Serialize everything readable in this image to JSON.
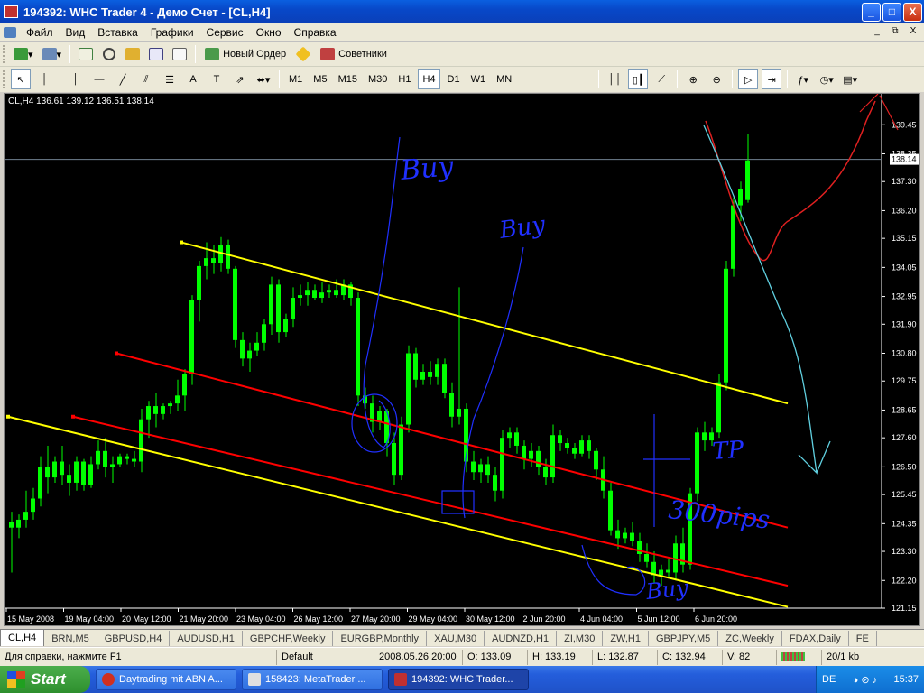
{
  "window": {
    "title": "194392: WHC Trader 4 - Демо Счет - [CL,H4]",
    "buttons": {
      "minimize": "_",
      "maximize": "□",
      "close": "X"
    }
  },
  "menu": {
    "items": [
      "Файл",
      "Вид",
      "Вставка",
      "Графики",
      "Сервис",
      "Окно",
      "Справка"
    ],
    "mdi_buttons": [
      "_",
      "⧉",
      "X"
    ]
  },
  "toolbar1": {
    "new_order_label": "Новый Ордер",
    "experts_label": "Советники"
  },
  "toolbar2": {
    "timeframes": [
      "M1",
      "M5",
      "M15",
      "M30",
      "H1",
      "H4",
      "D1",
      "W1",
      "MN"
    ],
    "selected_timeframe": "H4"
  },
  "chart": {
    "info_line": "CL,H4  136.61 139.12 136.51 138.14",
    "current_price_label": "138.14",
    "price_line_value": 138.14,
    "colors": {
      "background": "#000000",
      "candle": "#00ff00",
      "channel_outer": "#ffff00",
      "channel_inner": "#ff0000",
      "axis_text": "#ffffff",
      "annotation_blue": "#2030ff",
      "projection_red": "#e02020",
      "projection_cyan": "#60d0e0"
    },
    "handwritten_notes": [
      "Buy",
      "Buy",
      "TP",
      "300pips",
      "Buy"
    ]
  },
  "chart_data": {
    "type": "candlestick",
    "symbol": "CL",
    "timeframe": "H4",
    "ylim": [
      121.15,
      140.45
    ],
    "y_ticks": [
      139.45,
      138.35,
      137.3,
      136.2,
      135.15,
      134.05,
      132.95,
      131.9,
      130.8,
      129.75,
      128.65,
      127.6,
      126.5,
      125.45,
      124.35,
      123.3,
      122.2,
      121.15
    ],
    "x_labels": [
      "15 May 2008",
      "19 May 04:00",
      "20 May 12:00",
      "21 May 20:00",
      "23 May 04:00",
      "26 May 12:00",
      "27 May 20:00",
      "29 May 04:00",
      "30 May 12:00",
      "2 Jun 20:00",
      "4 Jun 04:00",
      "5 Jun 12:00",
      "6 Jun 20:00"
    ],
    "candles": [
      [
        124.4,
        124.8,
        122.5,
        124.2
      ],
      [
        124.2,
        124.7,
        123.8,
        124.5
      ],
      [
        124.5,
        125.6,
        124.2,
        124.8
      ],
      [
        124.8,
        125.7,
        124.5,
        125.3
      ],
      [
        125.3,
        126.9,
        125.0,
        126.5
      ],
      [
        126.5,
        127.3,
        125.5,
        126.1
      ],
      [
        126.1,
        126.9,
        125.9,
        126.7
      ],
      [
        126.7,
        127.3,
        125.8,
        126.2
      ],
      [
        126.2,
        126.6,
        125.4,
        125.9
      ],
      [
        125.9,
        126.9,
        125.6,
        126.7
      ],
      [
        126.7,
        126.8,
        125.6,
        125.8
      ],
      [
        125.8,
        126.9,
        125.7,
        126.6
      ],
      [
        126.6,
        127.5,
        126.4,
        127.1
      ],
      [
        127.1,
        127.6,
        126.1,
        126.5
      ],
      [
        126.5,
        126.9,
        125.9,
        126.6
      ],
      [
        126.6,
        127.0,
        126.5,
        126.9
      ],
      [
        126.9,
        127.0,
        126.6,
        126.8
      ],
      [
        126.8,
        127.1,
        126.5,
        126.7
      ],
      [
        126.7,
        128.7,
        126.3,
        128.3
      ],
      [
        128.3,
        129.0,
        127.6,
        128.8
      ],
      [
        128.8,
        129.3,
        128.0,
        128.5
      ],
      [
        128.5,
        128.9,
        128.3,
        128.8
      ],
      [
        128.8,
        129.0,
        128.5,
        128.9
      ],
      [
        128.9,
        129.8,
        128.6,
        129.2
      ],
      [
        129.2,
        130.2,
        128.6,
        130.0
      ],
      [
        130.0,
        133.0,
        129.6,
        132.8
      ],
      [
        132.8,
        134.3,
        132.0,
        134.1
      ],
      [
        134.1,
        135.0,
        133.6,
        134.4
      ],
      [
        134.4,
        134.9,
        133.8,
        134.2
      ],
      [
        134.2,
        135.2,
        133.9,
        134.9
      ],
      [
        134.9,
        135.1,
        133.8,
        134.0
      ],
      [
        134.0,
        134.1,
        131.0,
        131.3
      ],
      [
        131.3,
        131.6,
        130.3,
        130.6
      ],
      [
        130.6,
        131.2,
        130.1,
        130.9
      ],
      [
        130.9,
        131.6,
        130.7,
        131.2
      ],
      [
        131.2,
        132.1,
        130.9,
        131.9
      ],
      [
        131.9,
        133.7,
        131.5,
        133.4
      ],
      [
        133.4,
        133.6,
        131.2,
        131.6
      ],
      [
        131.6,
        132.3,
        131.4,
        132.1
      ],
      [
        132.1,
        133.3,
        131.8,
        132.9
      ],
      [
        132.9,
        133.4,
        132.6,
        133.0
      ],
      [
        133.0,
        133.5,
        132.6,
        133.2
      ],
      [
        133.2,
        133.4,
        132.8,
        132.9
      ],
      [
        132.9,
        133.5,
        132.7,
        133.1
      ],
      [
        133.1,
        133.4,
        132.9,
        133.2
      ],
      [
        133.2,
        133.6,
        132.9,
        133.0
      ],
      [
        133.0,
        133.6,
        132.8,
        133.4
      ],
      [
        133.4,
        133.5,
        132.6,
        132.9
      ],
      [
        132.9,
        133.1,
        128.8,
        129.2
      ],
      [
        129.2,
        129.5,
        128.7,
        128.9
      ],
      [
        128.9,
        129.2,
        127.8,
        128.2
      ],
      [
        128.2,
        128.8,
        127.9,
        128.6
      ],
      [
        128.6,
        128.7,
        126.9,
        127.4
      ],
      [
        127.4,
        127.8,
        125.8,
        126.2
      ],
      [
        126.2,
        128.4,
        126.0,
        128.1
      ],
      [
        128.1,
        131.1,
        127.8,
        130.8
      ],
      [
        130.8,
        131.0,
        129.5,
        129.8
      ],
      [
        129.8,
        130.4,
        129.6,
        130.1
      ],
      [
        130.1,
        130.5,
        129.6,
        129.9
      ],
      [
        129.9,
        130.6,
        129.6,
        130.4
      ],
      [
        130.4,
        130.6,
        129.1,
        129.3
      ],
      [
        129.3,
        129.7,
        128.0,
        128.4
      ],
      [
        128.4,
        133.3,
        128.1,
        128.7
      ],
      [
        128.7,
        128.9,
        126.3,
        126.7
      ],
      [
        126.7,
        127.1,
        126.0,
        126.3
      ],
      [
        126.3,
        126.8,
        125.9,
        126.6
      ],
      [
        126.6,
        126.9,
        125.9,
        126.2
      ],
      [
        126.2,
        126.5,
        125.2,
        125.6
      ],
      [
        125.6,
        127.9,
        125.3,
        127.6
      ],
      [
        127.6,
        128.0,
        127.2,
        127.8
      ],
      [
        127.8,
        128.0,
        127.0,
        127.3
      ],
      [
        127.3,
        127.5,
        126.4,
        126.8
      ],
      [
        126.8,
        127.4,
        126.5,
        127.1
      ],
      [
        127.1,
        127.3,
        126.2,
        126.5
      ],
      [
        126.5,
        126.8,
        125.8,
        126.1
      ],
      [
        126.1,
        128.1,
        125.9,
        127.7
      ],
      [
        127.7,
        127.9,
        127.1,
        127.4
      ],
      [
        127.4,
        127.6,
        127.0,
        127.2
      ],
      [
        127.2,
        127.4,
        126.8,
        127.0
      ],
      [
        127.0,
        127.7,
        126.9,
        127.5
      ],
      [
        127.5,
        127.7,
        126.8,
        127.1
      ],
      [
        127.1,
        127.2,
        126.0,
        126.4
      ],
      [
        126.4,
        126.9,
        125.3,
        125.6
      ],
      [
        125.6,
        125.9,
        123.9,
        124.1
      ],
      [
        124.1,
        124.5,
        123.4,
        123.8
      ],
      [
        123.8,
        124.2,
        123.6,
        124.0
      ],
      [
        124.0,
        124.4,
        123.5,
        123.7
      ],
      [
        123.7,
        124.0,
        122.9,
        123.2
      ],
      [
        123.2,
        123.6,
        122.7,
        122.9
      ],
      [
        122.9,
        123.3,
        122.1,
        122.4
      ],
      [
        122.4,
        122.8,
        122.0,
        122.6
      ],
      [
        122.6,
        123.0,
        122.3,
        122.5
      ],
      [
        122.5,
        123.9,
        122.2,
        123.6
      ],
      [
        123.6,
        124.2,
        122.5,
        122.8
      ],
      [
        122.8,
        125.7,
        122.6,
        125.5
      ],
      [
        125.5,
        128.0,
        125.2,
        127.8
      ],
      [
        127.8,
        128.2,
        127.1,
        127.5
      ],
      [
        127.5,
        128.0,
        127.3,
        127.8
      ],
      [
        127.8,
        130.0,
        127.6,
        129.7
      ],
      [
        129.7,
        134.3,
        129.4,
        134.0
      ],
      [
        134.0,
        136.7,
        133.7,
        136.4
      ],
      [
        136.4,
        137.3,
        135.8,
        137.0
      ],
      [
        136.6,
        139.1,
        136.5,
        138.1
      ]
    ],
    "channel_lines": [
      {
        "color": "#ffff00",
        "from": {
          "bar": 24,
          "price": 135.0
        },
        "to": {
          "bar": 108,
          "price": 128.9
        }
      },
      {
        "color": "#ffff00",
        "from": {
          "bar": 0,
          "price": 128.4
        },
        "to": {
          "bar": 108,
          "price": 121.2
        }
      },
      {
        "color": "#ff0000",
        "from": {
          "bar": 15,
          "price": 130.8
        },
        "to": {
          "bar": 108,
          "price": 124.2
        }
      },
      {
        "color": "#ff0000",
        "from": {
          "bar": 9,
          "price": 128.4
        },
        "to": {
          "bar": 108,
          "price": 122.0
        }
      }
    ]
  },
  "tabs": {
    "items": [
      "CL,H4",
      "BRN,M5",
      "GBPUSD,H4",
      "AUDUSD,H1",
      "GBPCHF,Weekly",
      "EURGBP,Monthly",
      "XAU,M30",
      "AUDNZD,H1",
      "ZI,M30",
      "ZW,H1",
      "GBPJPY,M5",
      "ZC,Weekly",
      "FDAX,Daily",
      "FE"
    ],
    "active": "CL,H4"
  },
  "status": {
    "help": "Для справки, нажмите F1",
    "profile": "Default",
    "datetime": "2008.05.26 20:00",
    "open": "O: 133.09",
    "high": "H: 133.19",
    "low": "L: 132.87",
    "close": "C: 132.94",
    "volume": "V: 82",
    "traffic": "20/1 kb"
  },
  "taskbar": {
    "start_label": "Start",
    "tasks": [
      "Daytrading mit ABN A...",
      "158423: MetaTrader ...",
      "194392: WHC Trader..."
    ],
    "active_task": 2,
    "language": "DE",
    "clock": "15:37"
  }
}
